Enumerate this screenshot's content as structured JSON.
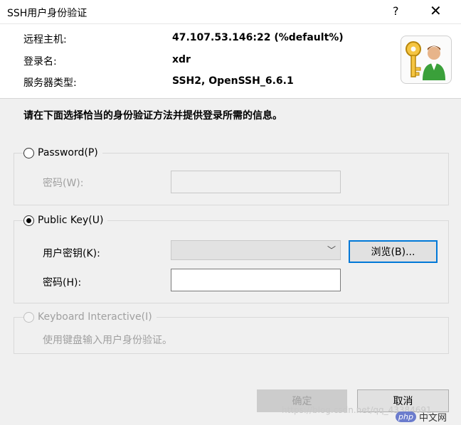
{
  "window": {
    "title": "SSH用户身份验证",
    "help_label": "?",
    "close_label": "✕"
  },
  "info": {
    "host_label": "远程主机:",
    "host_value": "47.107.53.146:22 (%default%)",
    "login_label": "登录名:",
    "login_value": "xdr",
    "server_label": "服务器类型:",
    "server_value": "SSH2, OpenSSH_6.6.1",
    "icon": "key-user-icon"
  },
  "instruction": "请在下面选择恰当的身份验证方法并提供登录所需的信息。",
  "password_group": {
    "radio_label": "Password(P)",
    "checked": false,
    "password_label": "密码(W):",
    "password_value": ""
  },
  "pubkey_group": {
    "radio_label": "Public Key(U)",
    "checked": true,
    "user_key_label": "用户密钥(K):",
    "user_key_value": "",
    "browse_label": "浏览(B)...",
    "password_label": "密码(H):",
    "password_value": ""
  },
  "keyboard_group": {
    "radio_label": "Keyboard Interactive(I)",
    "checked": false,
    "description": "使用键盘输入用户身份验证。"
  },
  "buttons": {
    "ok_label": "确定",
    "cancel_label": "取消"
  },
  "watermark": {
    "text": "https://blog.csdn.net/qq_43384691",
    "badge_php": "php",
    "badge_cn": "中文网"
  },
  "colors": {
    "focus_border": "#0078d7",
    "dialog_bg": "#f0f0f0"
  }
}
